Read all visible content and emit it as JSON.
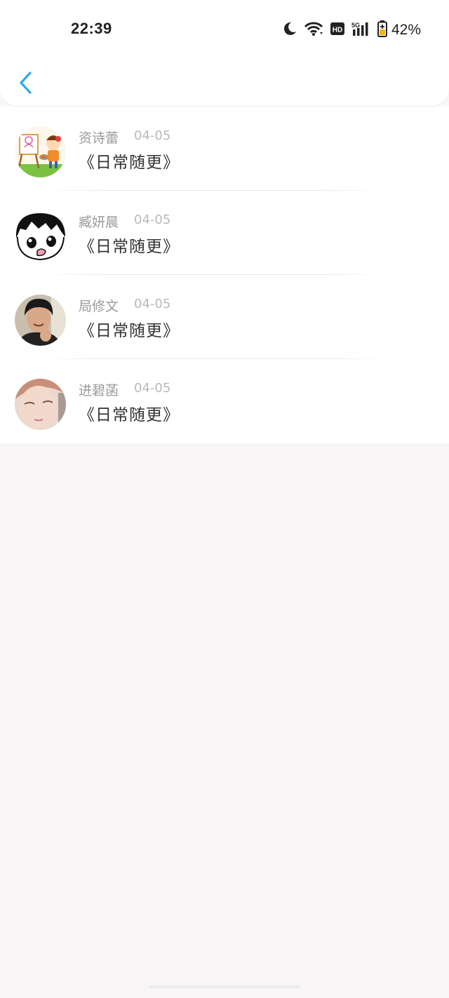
{
  "status_bar": {
    "time": "22:39",
    "battery": "42%",
    "icons": [
      "moon-icon",
      "wifi-icon",
      "hd-icon",
      "5g-signal-icon",
      "battery-icon"
    ],
    "hd_label": "HD",
    "network_label": "5G"
  },
  "header": {
    "back_icon": "chevron-left-icon",
    "accent_color": "#2ea7f0"
  },
  "messages": [
    {
      "name": "资诗蕾",
      "date": "04-05",
      "title": "《日常随更》",
      "avatar": "cartoon-painter-avatar"
    },
    {
      "name": "臧妍晨",
      "date": "04-05",
      "title": "《日常随更》",
      "avatar": "cartoon-face-avatar"
    },
    {
      "name": "局修文",
      "date": "04-05",
      "title": "《日常随更》",
      "avatar": "photo-person-avatar"
    },
    {
      "name": "进碧菡",
      "date": "04-05",
      "title": "《日常随更》",
      "avatar": "photo-closeup-avatar"
    }
  ]
}
